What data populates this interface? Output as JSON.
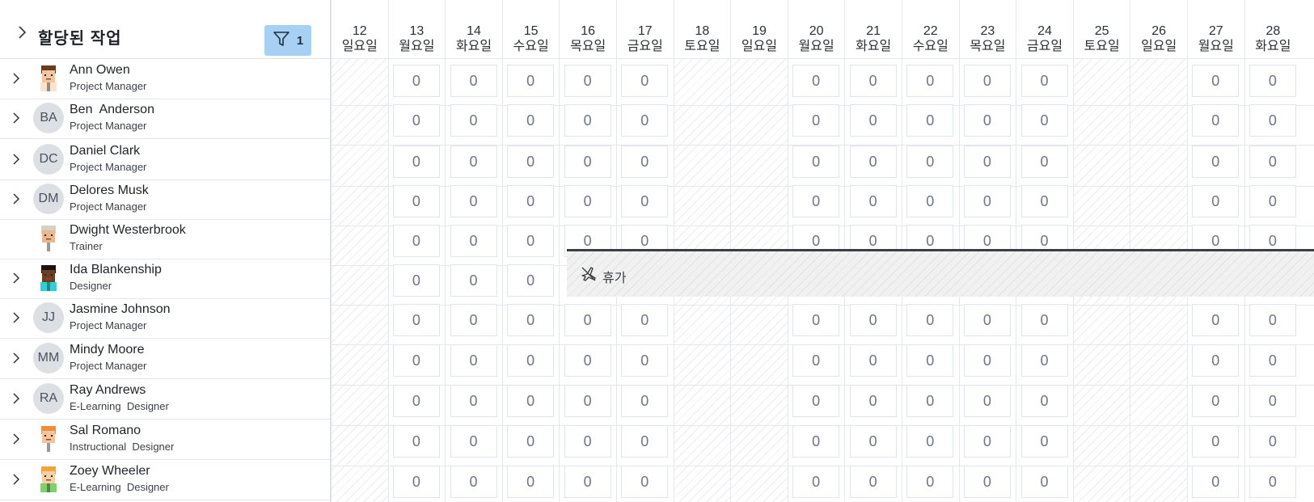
{
  "header": {
    "title": "할당된 작업",
    "filter_count": "1"
  },
  "people": [
    {
      "name": "Ann Owen",
      "role": "Project Manager",
      "avatar": "pic-ann",
      "initials": "",
      "expandable": true,
      "timeoff": false
    },
    {
      "name": "Ben  Anderson",
      "role": "Project Manager",
      "avatar": "initials",
      "initials": "BA",
      "expandable": true,
      "timeoff": false
    },
    {
      "name": "Daniel Clark",
      "role": "Project Manager",
      "avatar": "initials",
      "initials": "DC",
      "expandable": true,
      "timeoff": false
    },
    {
      "name": "Delores Musk",
      "role": "Project Manager",
      "avatar": "initials",
      "initials": "DM",
      "expandable": true,
      "timeoff": false
    },
    {
      "name": "Dwight Westerbrook",
      "role": "Trainer",
      "avatar": "pic-dwight",
      "initials": "",
      "expandable": false,
      "timeoff": false
    },
    {
      "name": "Ida Blankenship",
      "role": "Designer",
      "avatar": "pic-ida",
      "initials": "",
      "expandable": true,
      "timeoff": true
    },
    {
      "name": "Jasmine Johnson",
      "role": "Project Manager",
      "avatar": "initials",
      "initials": "JJ",
      "expandable": true,
      "timeoff": false
    },
    {
      "name": "Mindy Moore",
      "role": "Project Manager",
      "avatar": "initials",
      "initials": "MM",
      "expandable": true,
      "timeoff": false
    },
    {
      "name": "Ray Andrews",
      "role": "E-Learning  Designer",
      "avatar": "initials",
      "initials": "RA",
      "expandable": true,
      "timeoff": false
    },
    {
      "name": "Sal Romano",
      "role": "Instructional  Designer",
      "avatar": "pic-sal",
      "initials": "",
      "expandable": true,
      "timeoff": false
    },
    {
      "name": "Zoey Wheeler",
      "role": "E-Learning  Designer",
      "avatar": "pic-zoey",
      "initials": "",
      "expandable": true,
      "timeoff": false
    }
  ],
  "days": [
    {
      "num": "12",
      "dow": "일요일",
      "off": true
    },
    {
      "num": "13",
      "dow": "월요일",
      "off": false
    },
    {
      "num": "14",
      "dow": "화요일",
      "off": false
    },
    {
      "num": "15",
      "dow": "수요일",
      "off": false
    },
    {
      "num": "16",
      "dow": "목요일",
      "off": false
    },
    {
      "num": "17",
      "dow": "금요일",
      "off": false
    },
    {
      "num": "18",
      "dow": "토요일",
      "off": true
    },
    {
      "num": "19",
      "dow": "일요일",
      "off": true
    },
    {
      "num": "20",
      "dow": "월요일",
      "off": false
    },
    {
      "num": "21",
      "dow": "화요일",
      "off": false
    },
    {
      "num": "22",
      "dow": "수요일",
      "off": false
    },
    {
      "num": "23",
      "dow": "목요일",
      "off": false
    },
    {
      "num": "24",
      "dow": "금요일",
      "off": false
    },
    {
      "num": "25",
      "dow": "토요일",
      "off": true
    },
    {
      "num": "26",
      "dow": "일요일",
      "off": true
    },
    {
      "num": "27",
      "dow": "월요일",
      "off": false
    },
    {
      "num": "28",
      "dow": "화요일",
      "off": false
    }
  ],
  "cell_value": "0",
  "timeoff_label": "휴가",
  "colors": {
    "filter_bg": "#a8d0f5",
    "timeoff_bar": "#3b3f45"
  }
}
